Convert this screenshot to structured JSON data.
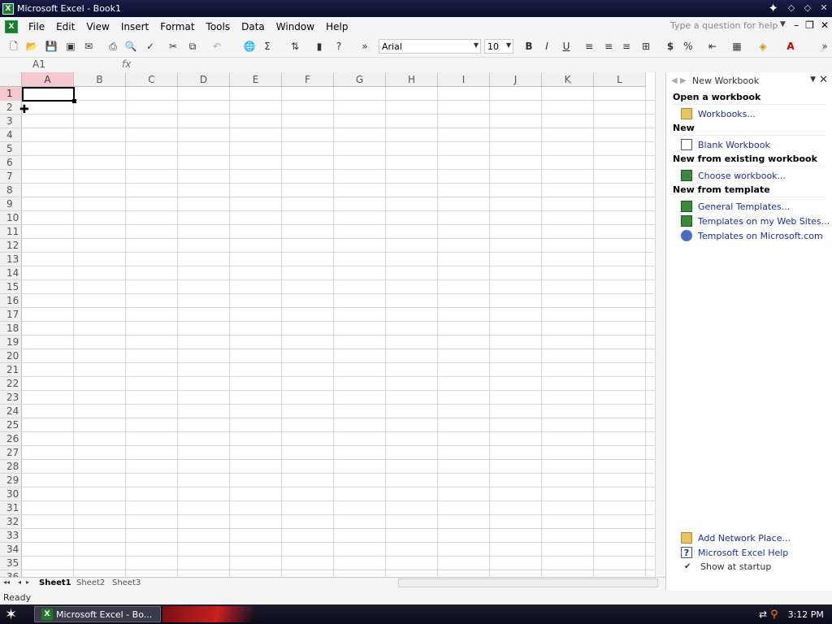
{
  "window": {
    "title": "Microsoft Excel - Book1"
  },
  "menu": [
    "File",
    "Edit",
    "View",
    "Insert",
    "Format",
    "Tools",
    "Data",
    "Window",
    "Help"
  ],
  "ask": {
    "placeholder": "Type a question for help"
  },
  "toolbar": {
    "font": "Arial",
    "size": "10"
  },
  "formula": {
    "namebox": "A1",
    "fx": "fx"
  },
  "grid": {
    "columns": [
      "A",
      "B",
      "C",
      "D",
      "E",
      "F",
      "G",
      "H",
      "I",
      "J",
      "K",
      "L"
    ],
    "rows": [
      "1",
      "2",
      "3",
      "4",
      "5",
      "6",
      "7",
      "8",
      "9",
      "10",
      "11",
      "12",
      "13",
      "14",
      "15",
      "16",
      "17",
      "18",
      "19",
      "20",
      "21",
      "22",
      "23",
      "24",
      "25",
      "26",
      "27",
      "28",
      "29",
      "30",
      "31",
      "32",
      "33",
      "34",
      "35",
      "36"
    ],
    "active_cell": "A1"
  },
  "sheets": [
    "Sheet1",
    "Sheet2",
    "Sheet3"
  ],
  "status": "Ready",
  "taskpane": {
    "title": "New Workbook",
    "sections": [
      {
        "heading": "Open a workbook",
        "links": [
          {
            "icon": "open-folder-icon",
            "label": "Workbooks..."
          }
        ]
      },
      {
        "heading": "New",
        "links": [
          {
            "icon": "blank-document-icon",
            "label": "Blank Workbook"
          }
        ]
      },
      {
        "heading": "New from existing workbook",
        "links": [
          {
            "icon": "workbook-icon",
            "label": "Choose workbook..."
          }
        ]
      },
      {
        "heading": "New from template",
        "links": [
          {
            "icon": "templates-icon",
            "label": "General Templates..."
          },
          {
            "icon": "web-templates-icon",
            "label": "Templates on my Web Sites..."
          },
          {
            "icon": "globe-icon",
            "label": "Templates on Microsoft.com"
          }
        ]
      }
    ],
    "bottom_links": [
      {
        "icon": "network-folder-icon",
        "label": "Add Network Place..."
      },
      {
        "icon": "help-icon",
        "label": "Microsoft Excel Help"
      }
    ],
    "show_at_startup": "Show at startup",
    "show_at_startup_checked": true
  },
  "taskbar": {
    "button": "Microsoft Excel - Bo...",
    "clock": "3:12 PM"
  }
}
